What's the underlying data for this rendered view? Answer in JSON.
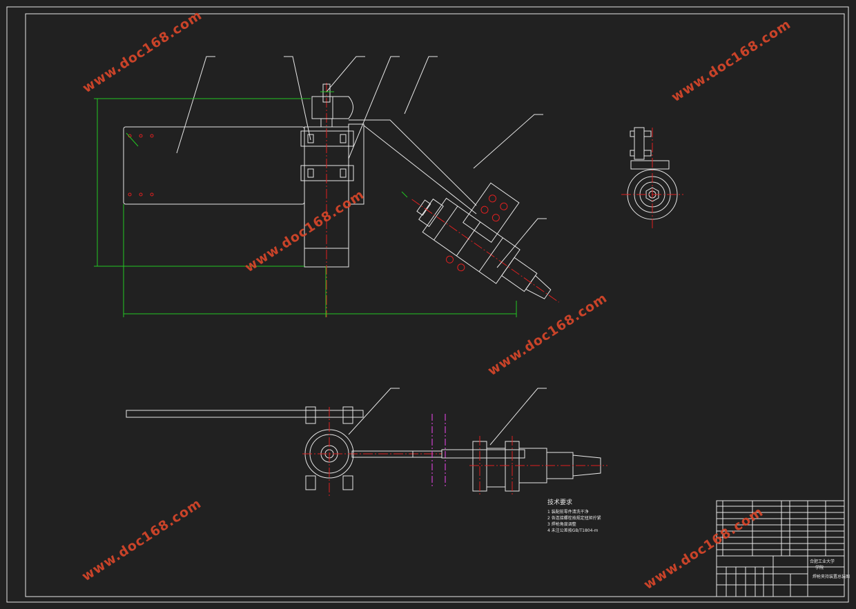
{
  "watermark": "www.doc168.com",
  "notes": {
    "title": "技术要求",
    "lines": [
      "1 装配前零件清洗干净",
      "2 各连接螺栓按规定扭矩拧紧",
      "3 焊枪角度调整",
      "4 未注公差按GB/T1804-m"
    ]
  },
  "title_block": {
    "school": "合肥工业大学",
    "dept": "学院",
    "drawing_title": "焊枪夹持装置总装图"
  },
  "colors": {
    "background": "#212121",
    "outline": "#e8e8e8",
    "dimension": "#22c822",
    "centerline": "#e02020",
    "phantom": "#d040d0",
    "watermark": "#d8462a"
  }
}
